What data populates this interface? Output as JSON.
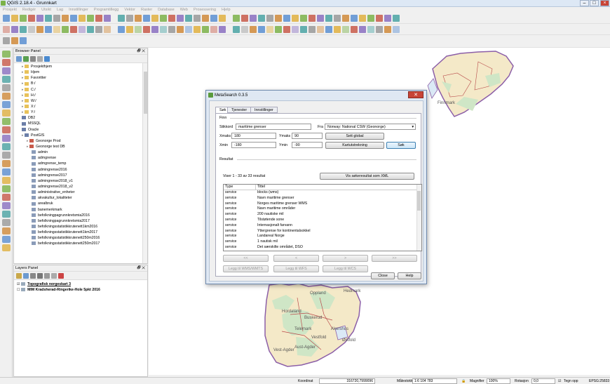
{
  "window": {
    "title": "QGIS 2.18.4 - Grunnkart"
  },
  "menu": [
    "Prosjekt",
    "Redigér",
    "Utsikt",
    "Lag",
    "Innstillinger",
    "Programtillegg",
    "Vektor",
    "Raster",
    "Database",
    "Web",
    "Prosessering",
    "Hjelp"
  ],
  "browser": {
    "title": "Browser Panel",
    "items": [
      {
        "label": "Prosjekthjem",
        "indent": 1,
        "kind": "folder"
      },
      {
        "label": "Hjem",
        "indent": 1,
        "kind": "folder"
      },
      {
        "label": "Favoritter",
        "indent": 1,
        "kind": "star"
      },
      {
        "label": "B:/",
        "indent": 1,
        "kind": "folder"
      },
      {
        "label": "C:/",
        "indent": 1,
        "kind": "folder"
      },
      {
        "label": "H:/",
        "indent": 1,
        "kind": "folder"
      },
      {
        "label": "W:/",
        "indent": 1,
        "kind": "folder"
      },
      {
        "label": "X:/",
        "indent": 1,
        "kind": "folder"
      },
      {
        "label": "Y:/",
        "indent": 1,
        "kind": "folder"
      },
      {
        "label": "DB2",
        "indent": 1,
        "kind": "db"
      },
      {
        "label": "MSSQL",
        "indent": 1,
        "kind": "db"
      },
      {
        "label": "Oracle",
        "indent": 1,
        "kind": "db"
      },
      {
        "label": "PostGIS",
        "indent": 1,
        "kind": "db"
      },
      {
        "label": "Geonorge Prod",
        "indent": 2,
        "kind": "conn"
      },
      {
        "label": "Geonorge test DB",
        "indent": 2,
        "kind": "conn"
      },
      {
        "label": "admin",
        "indent": 3,
        "kind": "table"
      },
      {
        "label": "admgrense",
        "indent": 3,
        "kind": "table"
      },
      {
        "label": "admgrense_temp",
        "indent": 3,
        "kind": "table"
      },
      {
        "label": "admingrense2016",
        "indent": 3,
        "kind": "table"
      },
      {
        "label": "admingrense2017",
        "indent": 3,
        "kind": "table"
      },
      {
        "label": "admingrense2018_v1",
        "indent": 3,
        "kind": "table"
      },
      {
        "label": "admingrense2018_v2",
        "indent": 3,
        "kind": "table"
      },
      {
        "label": "administrative_enheter",
        "indent": 3,
        "kind": "table"
      },
      {
        "label": "akvakultur_lokaliteter",
        "indent": 3,
        "kind": "table"
      },
      {
        "label": "arealbruk",
        "indent": 3,
        "kind": "table"
      },
      {
        "label": "banemerkmark",
        "indent": 3,
        "kind": "table"
      },
      {
        "label": "befolkningpagrunnkretsmia2016",
        "indent": 3,
        "kind": "table"
      },
      {
        "label": "befolkningpagrunnkretsmia2017",
        "indent": 3,
        "kind": "table"
      },
      {
        "label": "befolkningsstatistikkrutenett1km2016",
        "indent": 3,
        "kind": "table"
      },
      {
        "label": "befolkningsstatistikkrutenett1km2017",
        "indent": 3,
        "kind": "table"
      },
      {
        "label": "befolkningsstatistikkrutenett250m2016",
        "indent": 3,
        "kind": "table"
      },
      {
        "label": "befolkningsstatistikkrutenett250m2017",
        "indent": 3,
        "kind": "table"
      }
    ]
  },
  "layers": {
    "title": "Layers Panel",
    "items": [
      {
        "label": "Topografisk norgeskart 3",
        "checked": true,
        "bold": true
      },
      {
        "label": "MIM Kradsherad-Ringerike-Hole 5pkt 2016",
        "checked": false,
        "bold": true
      }
    ]
  },
  "map_labels": [
    {
      "text": "Finnmark"
    },
    {
      "text": "Oppland"
    },
    {
      "text": "Hedmark"
    },
    {
      "text": "Hordaland"
    },
    {
      "text": "Buskerud"
    },
    {
      "text": "Telemark"
    },
    {
      "text": "Akershus"
    },
    {
      "text": "Vestfold"
    },
    {
      "text": "Østfold"
    },
    {
      "text": "Vest-Agder"
    },
    {
      "text": "Aust-Agder"
    }
  ],
  "dialog": {
    "title": "MetaSearch 0.3.5",
    "tabs": [
      "Søk",
      "Tjenester",
      "Innstillinger"
    ],
    "find_label": "Finn",
    "keyword_label": "Stikkord",
    "keyword_value": "maritime grenser",
    "from_label": "Fra",
    "from_value": "Norway: National CSW (Geonorge)",
    "xmax_label": "Xmaks",
    "xmax_value": "180",
    "ymax_label": "Ymaks",
    "ymax_value": "90",
    "xmin_label": "Xmin",
    "xmin_value": "-180",
    "ymin_label": "Ymin",
    "ymin_value": "-90",
    "set_global": "Sett global",
    "map_extent": "Kartutstrekning",
    "search": "Søk",
    "results_label": "Resultat",
    "results_count": "Viser 1 - 33 av 33 resultat",
    "show_xml": "Vis søkeresultat som XML",
    "col_type": "Type",
    "col_title": "Tittel",
    "rows": [
      {
        "type": "service",
        "title": "blocks (wms)"
      },
      {
        "type": "service",
        "title": "Navn maritime grenser"
      },
      {
        "type": "service",
        "title": "Norges maritime grenser WMS"
      },
      {
        "type": "service",
        "title": "Navn maritime områder"
      },
      {
        "type": "service",
        "title": "200 nautiske mil"
      },
      {
        "type": "service",
        "title": "Tilstøtende sone"
      },
      {
        "type": "service",
        "title": "Internasjonalt farvann"
      },
      {
        "type": "service",
        "title": "Yttergrense for kontinentalsokkel"
      },
      {
        "type": "service",
        "title": "Landareal Norge"
      },
      {
        "type": "service",
        "title": "1 nautisk mil"
      },
      {
        "type": "service",
        "title": "Det særskilte området, DSO"
      }
    ],
    "nav": [
      "<<",
      "<",
      ">",
      ">>"
    ],
    "add_wms": "Legg til WMS/WMTS",
    "add_wfs": "Legg til WFS",
    "add_wcs": "Legg til WCS",
    "close": "Close",
    "help": "Help"
  },
  "status": {
    "coord_label": "Koordinat",
    "coord_value": "316720,7999096",
    "scale_label": "Målestokk",
    "scale_value": "1:6 104 783",
    "magnifier_label": "Magnifier",
    "magnifier_value": "100%",
    "rotation_label": "Rotasjon",
    "rotation_value": "0,0",
    "render_label": "Tegn opp",
    "crs": "EPSG:25833"
  },
  "colors": {
    "map_fill": "#f4e9c8",
    "map_border": "#8c5fa8",
    "accent": "#3c7fb1"
  }
}
